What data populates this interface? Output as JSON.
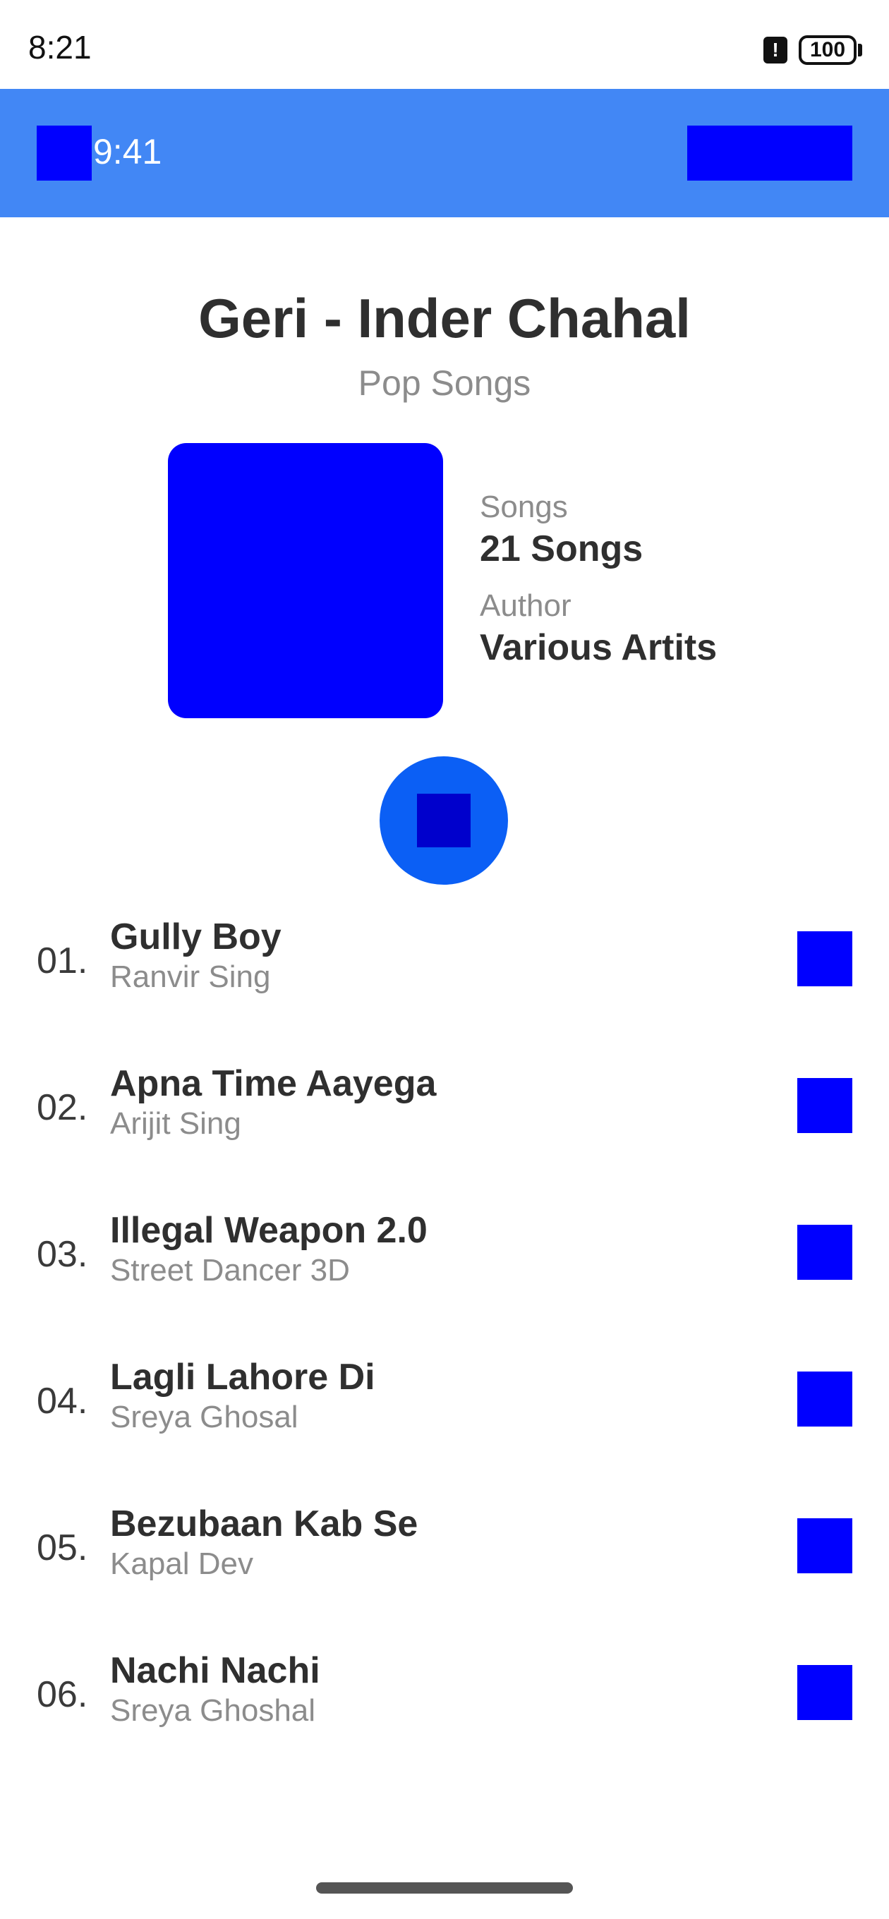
{
  "status_bar": {
    "time": "8:21",
    "battery": "100",
    "alert_glyph": "!"
  },
  "app_bar": {
    "time": "9:41",
    "menu_icon": "menu-icon",
    "actions_icon": "actions-icon"
  },
  "album": {
    "title": "Geri - Inder Chahal",
    "category": "Pop Songs",
    "songs_label": "Songs",
    "songs_value": "21 Songs",
    "author_label": "Author",
    "author_value": "Various Artits"
  },
  "tracks": [
    {
      "number": "01.",
      "title": "Gully Boy",
      "artist": "Ranvir Sing"
    },
    {
      "number": "02.",
      "title": "Apna Time Aayega",
      "artist": "Arijit Sing"
    },
    {
      "number": "03.",
      "title": "Illegal Weapon 2.0",
      "artist": "Street Dancer 3D"
    },
    {
      "number": "04.",
      "title": "Lagli Lahore Di",
      "artist": "Sreya Ghosal"
    },
    {
      "number": "05.",
      "title": "Bezubaan Kab Se",
      "artist": "Kapal Dev"
    },
    {
      "number": "06.",
      "title": "Nachi Nachi",
      "artist": "Sreya Ghoshal"
    }
  ],
  "colors": {
    "app_bar": "#4287f5",
    "placeholder": "#0000ff",
    "play_button": "#0b5ff5",
    "primary_text": "#2f2f2f",
    "secondary_text": "#8c8c8c"
  }
}
